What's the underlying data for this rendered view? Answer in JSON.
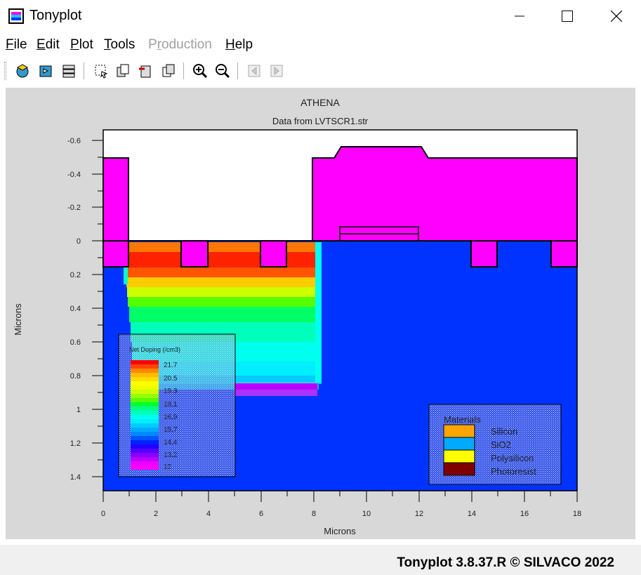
{
  "window": {
    "title": "Tonyplot",
    "icon": "tonyplot-app-icon",
    "controls": [
      "minimize-icon",
      "maximize-icon",
      "close-icon"
    ]
  },
  "menu": {
    "items": [
      {
        "label": "File",
        "enabled": true
      },
      {
        "label": "Edit",
        "enabled": true
      },
      {
        "label": "Plot",
        "enabled": true
      },
      {
        "label": "Tools",
        "enabled": true
      },
      {
        "label": "Production",
        "enabled": false
      },
      {
        "label": "Help",
        "enabled": true
      }
    ]
  },
  "toolbar": {
    "buttons": [
      "load-icon",
      "save-icon",
      "print-icon",
      "select-icon",
      "copy-icon",
      "delete-icon",
      "paste-icon",
      "zoom-in-icon",
      "zoom-out-icon",
      "back-icon",
      "forward-icon"
    ]
  },
  "plot": {
    "title": "ATHENA",
    "subtitle": "Data from LVTSCR1.str",
    "x_axis_label": "Microns",
    "y_axis_label": "Microns",
    "x_ticks": [
      "0",
      "2",
      "4",
      "6",
      "8",
      "10",
      "12",
      "14",
      "16",
      "18"
    ],
    "y_ticks": [
      "-0.6",
      "-0.4",
      "-0.2",
      "0",
      "0.2",
      "0.4",
      "0.6",
      "0.8",
      "1",
      "1.2",
      "1.4"
    ],
    "x_range": [
      0,
      18
    ],
    "y_range": [
      -0.66,
      1.47
    ],
    "colors": {
      "oxide": "#ff00ff",
      "substrate": "#0033ff",
      "background": "#ffffff"
    },
    "legend_doping": {
      "title": "Net Doping (/cm3)",
      "labels": [
        "21.7",
        "20.5",
        "19.3",
        "18.1",
        "16.9",
        "15.7",
        "14.4",
        "13.2",
        "12"
      ]
    },
    "legend_materials": {
      "title": "Materials",
      "items": [
        {
          "label": "Silicon",
          "color": "#ffa500"
        },
        {
          "label": "SiO2",
          "color": "#00aaff"
        },
        {
          "label": "Polysilicon",
          "color": "#ffff00"
        },
        {
          "label": "Photoresist",
          "color": "#800000"
        }
      ]
    }
  },
  "status": {
    "text": "Tonyplot 3.8.37.R © SILVACO 2022"
  }
}
